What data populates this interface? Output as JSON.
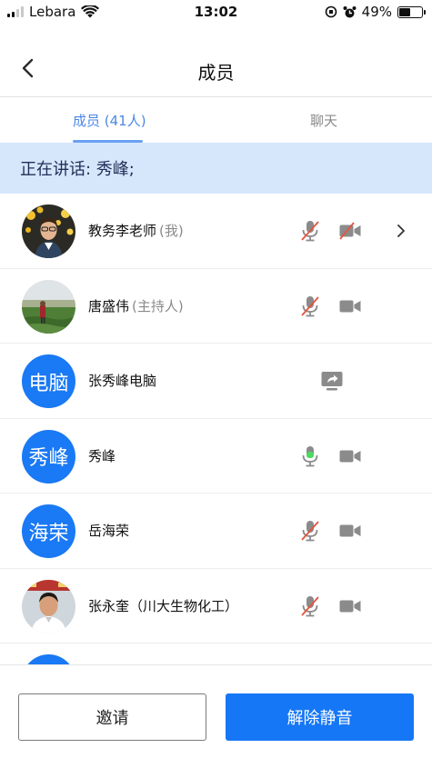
{
  "status_bar": {
    "carrier": "Lebara",
    "time": "13:02",
    "battery": "49%",
    "battery_level": 0.49
  },
  "header": {
    "title": "成员"
  },
  "tabs": [
    {
      "label": "成员 (41人)",
      "active": true
    },
    {
      "label": "聊天",
      "active": false
    }
  ],
  "speaking": {
    "text": "正在讲话: 秀峰;"
  },
  "members": [
    {
      "name": "教务李老师",
      "role": "(我)",
      "avatar": "photo-teacher",
      "mic": "muted",
      "camera": "off",
      "has_chevron": true
    },
    {
      "name": "唐盛伟",
      "role": "(主持人)",
      "avatar": "photo-field",
      "mic": "muted",
      "camera": "on"
    },
    {
      "name": "张秀峰电脑",
      "role": "",
      "avatar_text": "电脑",
      "share": true
    },
    {
      "name": "秀峰",
      "role": "",
      "avatar_text": "秀峰",
      "mic": "speaking",
      "camera": "on"
    },
    {
      "name": "岳海荣",
      "role": "",
      "avatar_text": "海荣",
      "mic": "muted",
      "camera": "on"
    },
    {
      "name": "张永奎（川大生物化工）",
      "role": "",
      "avatar": "photo-man",
      "mic": "muted",
      "camera": "on"
    }
  ],
  "buttons": {
    "invite": "邀请",
    "unmute": "解除静音"
  },
  "colors": {
    "accent": "#1677f6",
    "speaking_bg": "#d6e7fc",
    "muted_red": "#e5533d",
    "speaking_green": "#4cd964"
  }
}
